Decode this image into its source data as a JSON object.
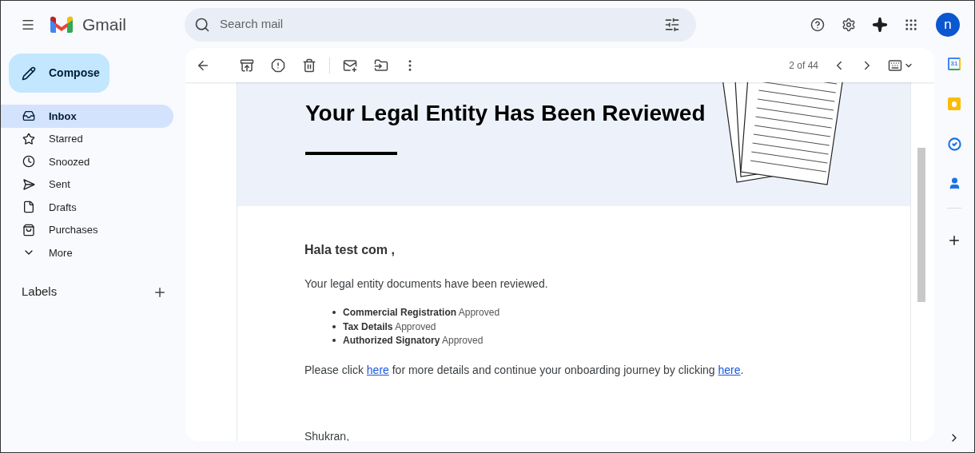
{
  "app": {
    "name": "Gmail"
  },
  "search": {
    "placeholder": "Search mail"
  },
  "account": {
    "initial": "n"
  },
  "compose": {
    "label": "Compose"
  },
  "sidebar": {
    "items": [
      {
        "label": "Inbox",
        "selected": true
      },
      {
        "label": "Starred",
        "selected": false
      },
      {
        "label": "Snoozed",
        "selected": false
      },
      {
        "label": "Sent",
        "selected": false
      },
      {
        "label": "Drafts",
        "selected": false
      },
      {
        "label": "Purchases",
        "selected": false
      },
      {
        "label": "More",
        "selected": false
      }
    ]
  },
  "labels": {
    "title": "Labels"
  },
  "toolbar": {
    "pagination": "2 of 44"
  },
  "email": {
    "banner_title": "Your Legal Entity Has Been Reviewed",
    "greeting": "Hala test com ,",
    "intro": "Your legal entity documents have been reviewed.",
    "items": [
      "**Commercial Registration** Approved",
      "**Tax Details** Approved",
      "**Authorized Signatory** Approved"
    ],
    "sentence": [
      {
        "kind": "text",
        "text": "Please click "
      },
      {
        "kind": "link",
        "text": "here"
      },
      {
        "kind": "text",
        "text": " for more details and continue your onboarding journey by clicking "
      },
      {
        "kind": "link",
        "text": "here"
      },
      {
        "kind": "text",
        "text": "."
      }
    ],
    "signoff": "Shukran,"
  },
  "side_panel": {
    "calendar_day": "31"
  }
}
